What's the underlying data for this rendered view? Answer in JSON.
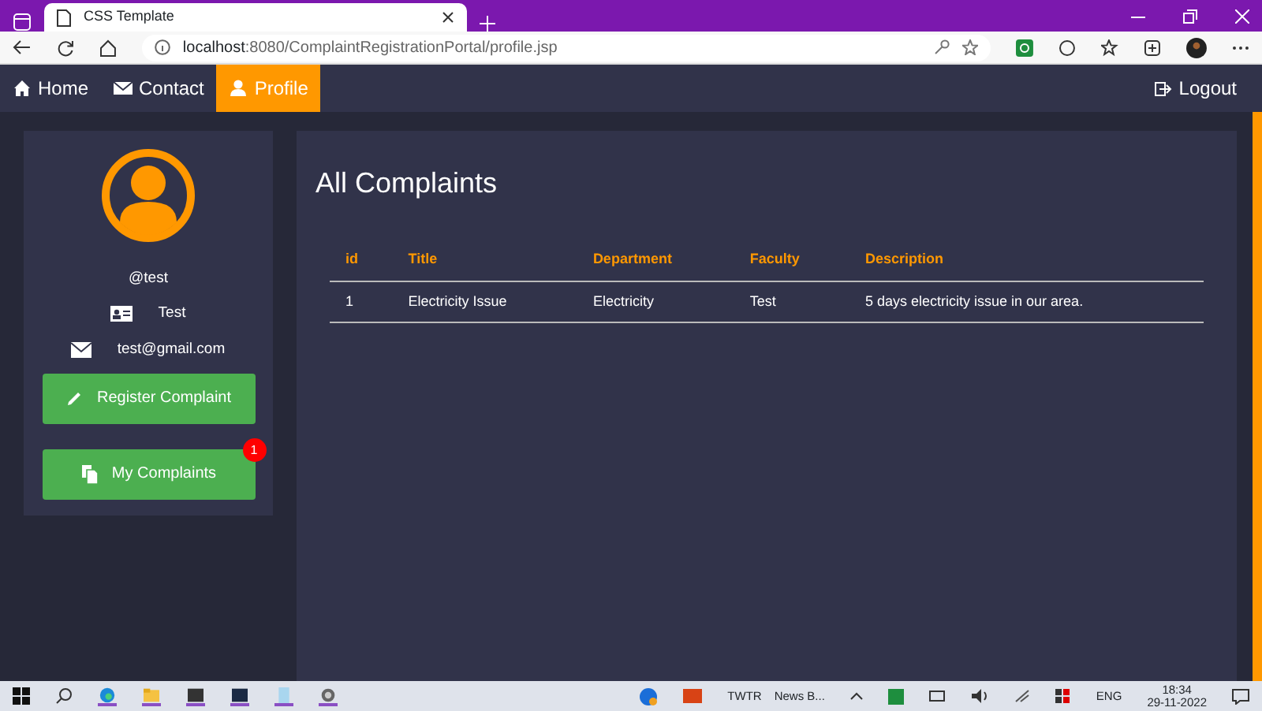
{
  "browser": {
    "tab_title": "CSS Template",
    "url_host": "localhost",
    "url_rest": ":8080/ComplaintRegistrationPortal/profile.jsp"
  },
  "navbar": {
    "items": [
      {
        "label": "Home",
        "selected": false
      },
      {
        "label": "Contact",
        "selected": false
      },
      {
        "label": "Profile",
        "selected": true
      }
    ],
    "logout": "Logout"
  },
  "profile": {
    "username": "@test",
    "name": "Test",
    "email": "test@gmail.com",
    "buttons": [
      {
        "label": "Register Complaint"
      },
      {
        "label": "My Complaints",
        "badge": "1"
      }
    ]
  },
  "complaints": {
    "heading": "All Complaints",
    "columns": [
      "id",
      "Title",
      "Department",
      "Faculty",
      "Description"
    ],
    "rows": [
      [
        "1",
        "Electricity Issue",
        "Electricity",
        "Test",
        "5 days electricity issue in our area."
      ]
    ]
  },
  "taskbar": {
    "weather_app": "TWTR",
    "news": "News B...",
    "language": "ENG",
    "time": "18:34",
    "date": "29-11-2022"
  }
}
